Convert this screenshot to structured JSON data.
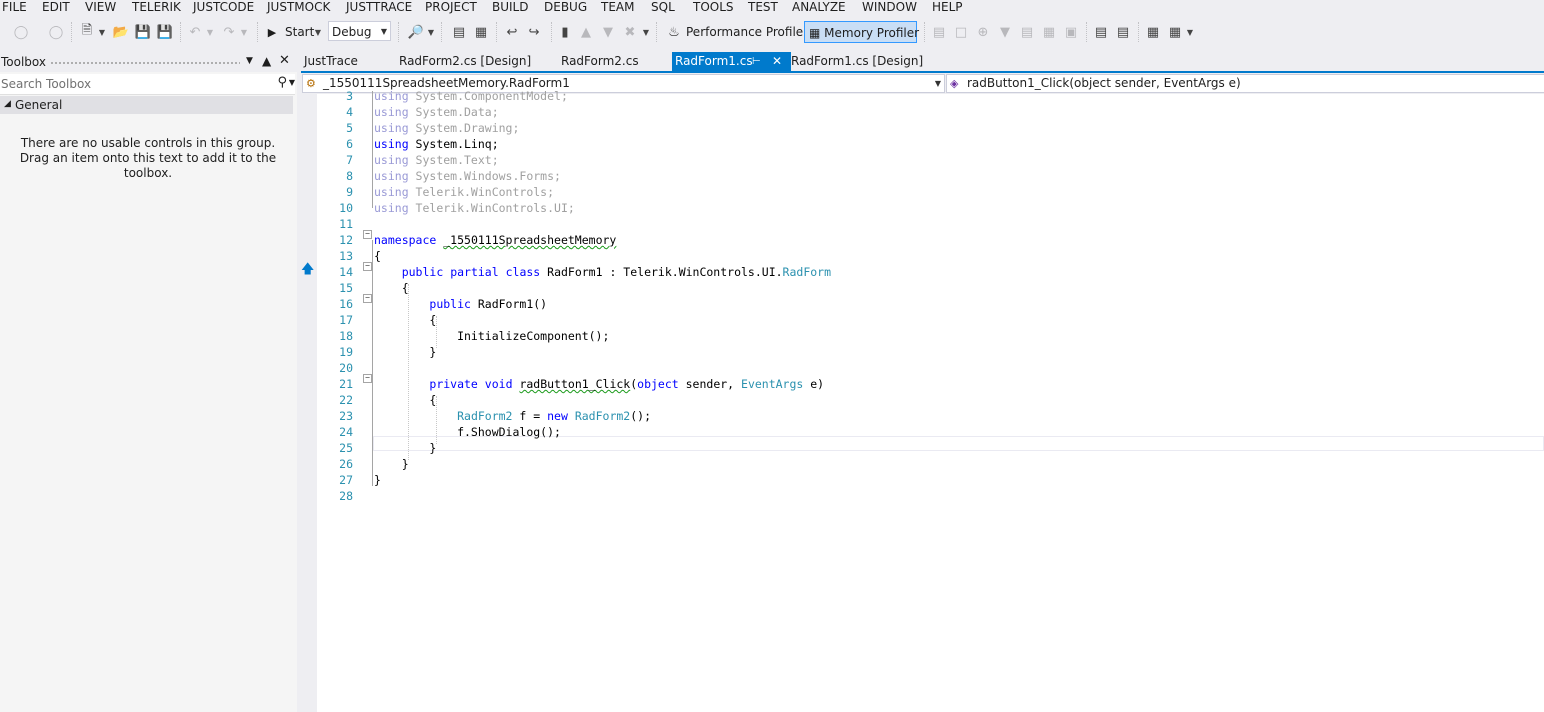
{
  "menu": [
    "FILE",
    "EDIT",
    "VIEW",
    "TELERIK",
    "JUSTCODE",
    "JUSTMOCK",
    "JUSTTRACE",
    "PROJECT",
    "BUILD",
    "DEBUG",
    "TEAM",
    "SQL",
    "TOOLS",
    "TEST",
    "ANALYZE",
    "WINDOW",
    "HELP"
  ],
  "toolbar": {
    "start_label": "Start",
    "config_value": "Debug",
    "performance_profiler_label": "Performance Profiler",
    "memory_profiler_label": "Memory Profiler"
  },
  "toolbox": {
    "title": "Toolbox",
    "search_placeholder": "Search Toolbox",
    "group_label": "General",
    "empty_message": "There are no usable controls in this group. Drag an item onto this text to add it to the toolbox."
  },
  "tabs": [
    {
      "label": "JustTrace"
    },
    {
      "label": "RadForm2.cs [Design]"
    },
    {
      "label": "RadForm2.cs"
    },
    {
      "label": "RadForm1.cs",
      "active": true
    },
    {
      "label": "RadForm1.cs [Design]"
    }
  ],
  "navbar": {
    "type_selector": "_1550111SpreadsheetMemory.RadForm1",
    "member_selector": "radButton1_Click(object sender, EventArgs e)"
  },
  "code": {
    "line_numbers": [
      "3",
      "4",
      "5",
      "6",
      "7",
      "8",
      "9",
      "10",
      "11",
      "12",
      "13",
      "14",
      "15",
      "16",
      "17",
      "18",
      "19",
      "20",
      "21",
      "22",
      "23",
      "24",
      "25",
      "26",
      "27",
      "28"
    ],
    "lines": [
      "using System.ComponentModel;",
      "using System.Data;",
      "using System.Drawing;",
      "using System.Linq;",
      "using System.Text;",
      "using System.Windows.Forms;",
      "using Telerik.WinControls;",
      "using Telerik.WinControls.UI;",
      "",
      "namespace _1550111SpreadsheetMemory",
      "{",
      "    public partial class RadForm1 : Telerik.WinControls.UI.RadForm",
      "    {",
      "        public RadForm1()",
      "        {",
      "            InitializeComponent();",
      "        }",
      "",
      "        private void radButton1_Click(object sender, EventArgs e)",
      "        {",
      "            RadForm2 f = new RadForm2();",
      "            f.ShowDialog();",
      "        }",
      "    }",
      "}",
      ""
    ]
  },
  "colors": {
    "accent": "#007acc",
    "keyword": "#0000ff",
    "type": "#2b91af",
    "line_number": "#2b91af"
  }
}
